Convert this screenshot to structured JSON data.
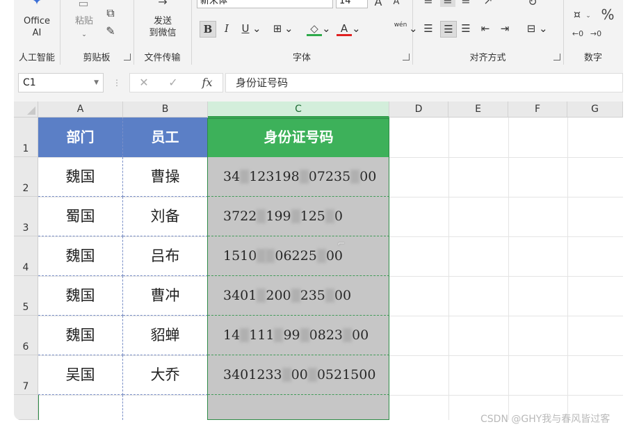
{
  "ribbon": {
    "ai_group": {
      "office_ai": "Office\nAI",
      "label": "人工智能"
    },
    "clipboard": {
      "paste": "粘贴",
      "label": "剪贴板"
    },
    "transfer": {
      "send_wechat": "发送\n到微信",
      "label": "文件传输"
    },
    "font": {
      "font_name": "新宋体",
      "font_size": "14",
      "bold": "B",
      "italic": "I",
      "underline": "U",
      "phonetic": "wén",
      "label": "字体"
    },
    "alignment": {
      "label": "对齐方式"
    },
    "number": {
      "percent": "%",
      "label": "数字"
    }
  },
  "formula_bar": {
    "name_box": "C1",
    "fx": "fx",
    "value": "身份证号码"
  },
  "columns": [
    "A",
    "B",
    "C",
    "D",
    "E",
    "F",
    "G"
  ],
  "rows": [
    "1",
    "2",
    "3",
    "4",
    "5",
    "6",
    "7"
  ],
  "table": {
    "headers": [
      "部门",
      "员工",
      "身份证号码"
    ],
    "rows": [
      {
        "dept": "魏国",
        "name": "曹操",
        "id_parts": [
          "34",
          "123198",
          "07235",
          "00"
        ]
      },
      {
        "dept": "蜀国",
        "name": "刘备",
        "id_parts": [
          "3722",
          "199",
          "125",
          "0"
        ]
      },
      {
        "dept": "魏国",
        "name": "吕布",
        "id_parts": [
          "1510",
          "06225",
          "00"
        ]
      },
      {
        "dept": "魏国",
        "name": "曹冲",
        "id_parts": [
          "3401",
          "200",
          "235",
          "00"
        ]
      },
      {
        "dept": "魏国",
        "name": "貂蝉",
        "id_parts": [
          "14",
          "111",
          "99",
          "0823",
          "00"
        ]
      },
      {
        "dept": "吴国",
        "name": "大乔",
        "id_parts": [
          "3401233",
          "00",
          "0521500"
        ]
      }
    ]
  },
  "watermark": "CSDN @GHY我与春风皆过客",
  "colors": {
    "header_blue": "#5b7fc6",
    "header_green": "#3db15a",
    "id_fill": "#c6c6c6",
    "selection": "#2e8b47"
  }
}
